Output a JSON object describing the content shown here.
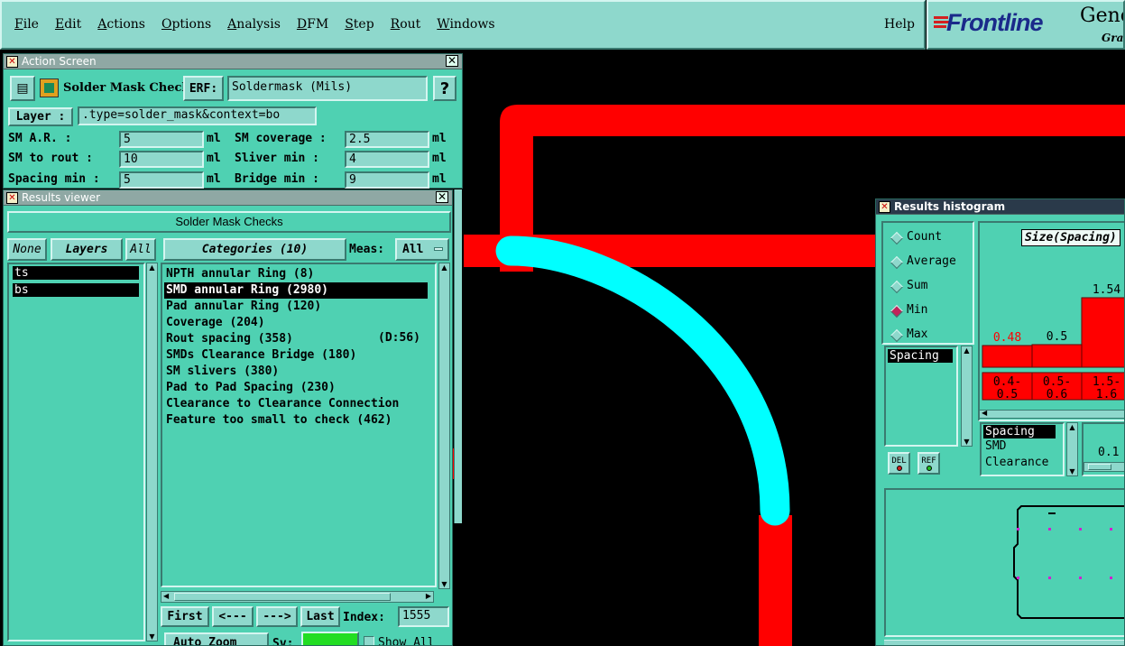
{
  "menubar": {
    "items": [
      "File",
      "Edit",
      "Actions",
      "Options",
      "Analysis",
      "DFM",
      "Step",
      "Rout",
      "Windows"
    ],
    "help": "Help"
  },
  "brand": {
    "logo": "Frontline",
    "title": "Gene",
    "subtitle": "Grap"
  },
  "action_screen": {
    "title": "Action Screen",
    "name": "Solder Mask Checks",
    "erf_label": "ERF:",
    "erf_value": "Soldermask (Mils)",
    "help_label": "?",
    "layer_label": "Layer :",
    "layer_value": ".type=solder_mask&context=bo",
    "params": [
      {
        "label": "SM A.R.     :",
        "value": "5",
        "unit": "ml"
      },
      {
        "label": "SM to rout  :",
        "value": "10",
        "unit": "ml"
      },
      {
        "label": "Spacing min :",
        "value": "5",
        "unit": "ml"
      },
      {
        "label": "SM coverage :",
        "value": "2.5",
        "unit": "ml"
      },
      {
        "label": "Sliver  min :",
        "value": "4",
        "unit": "ml"
      },
      {
        "label": "Bridge  min :",
        "value": "9",
        "unit": "ml"
      }
    ]
  },
  "results_viewer": {
    "title": "Results viewer",
    "header": "Solder Mask Checks",
    "none_btn": "None",
    "layers_btn": "Layers",
    "all_btn": "All",
    "categories_btn": "Categories (10)",
    "meas_label": "Meas:",
    "meas_value": "All",
    "layers": [
      "ts",
      "bs"
    ],
    "categories": [
      "NPTH annular Ring (8)",
      "SMD annular Ring (2980)",
      "Pad annular Ring (120)",
      "Coverage (204)",
      "Rout spacing (358)",
      "SMDs Clearance Bridge (180)",
      "SM slivers (380)",
      "Pad to Pad Spacing (230)",
      "Clearance to Clearance Connection",
      "Feature too small to check (462)"
    ],
    "rout_extra": "(D:56)",
    "selected_category": "SMD annular Ring (2980)",
    "nav": {
      "first": "First",
      "prev": "<---",
      "next": "--->",
      "last": "Last",
      "index_label": "Index:",
      "index_value": "1555"
    },
    "bottom": {
      "zoom": "Auto Zoom",
      "sv": "Sv:",
      "show_all": "Show All"
    }
  },
  "histogram": {
    "title": "Results histogram",
    "modes": [
      "Count",
      "Average",
      "Sum",
      "Min",
      "Max"
    ],
    "selected_mode": "Min",
    "size_label": "Size(Spacing)",
    "list1": [
      "Spacing"
    ],
    "list2": [
      "Spacing",
      "SMD",
      "Clearance"
    ],
    "del_label": "DEL",
    "ref_label": "REF",
    "scale_value": "0.1",
    "chart_data": {
      "type": "bar",
      "categories": [
        "0.4-0.5",
        "0.5-0.6",
        "1.5-1.6"
      ],
      "values": [
        0.48,
        0.5,
        1.54
      ],
      "value_labels": [
        "0.48",
        "0.5",
        "1.54"
      ],
      "bin_labels": [
        [
          "0.4-",
          "0.5"
        ],
        [
          "0.5-",
          "0.6"
        ],
        [
          "1.5-",
          "1.6"
        ]
      ]
    }
  },
  "colors": {
    "panel": "#4fd1b2",
    "panel_light": "#8ed8cc",
    "trace": "#ff0000",
    "highlight": "#00ffff",
    "canvas": "#000000"
  }
}
